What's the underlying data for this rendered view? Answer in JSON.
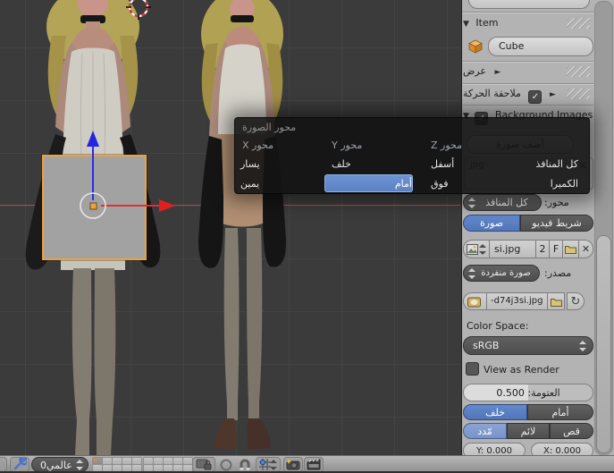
{
  "menu": {
    "title": "محور الصورة",
    "columns": [
      {
        "header": "محور X",
        "items": [
          "يسار",
          "يمين"
        ]
      },
      {
        "header": "محور Y",
        "items": [
          "خلف",
          "أمام"
        ]
      },
      {
        "header": "محور Z",
        "items": [
          "أسفل",
          "فوق"
        ]
      },
      {
        "header": "",
        "items": [
          "كل المنافذ",
          "الكميرا"
        ]
      }
    ],
    "selected": "أمام"
  },
  "sidebar": {
    "item_panel": {
      "title": "Item",
      "object_name": "Cube"
    },
    "display_panel": {
      "title": "عرض"
    },
    "motion_panel": {
      "title": "ملاحقة الحركة"
    },
    "background_panel": {
      "title": "Background Images",
      "add_image": "أضف صورة",
      "image_fragment": "jpg",
      "axis_label": "محور:",
      "axis_value": "كل المنافذ",
      "movie_clip": "شريط فيديو",
      "image": "صورة",
      "image_name": "si.jpg",
      "users": "2",
      "fake_user": "F",
      "source_label": "مصدر:",
      "source_value": "صورة منفردة",
      "file_path": "-d74j3si.jpg",
      "colorspace_label": "Color Space:",
      "colorspace_value": "sRGB",
      "view_as_render": "View as Render",
      "opacity": "العتومة: 0.500",
      "back": "خلف",
      "front": "أمام",
      "stretch": "مّدد",
      "fit": "لائم",
      "crop": "قص",
      "offset_x": "X: 0.000",
      "offset_y": "Y: 0.000"
    }
  },
  "toolbar": {
    "orientation": "عالمي0"
  },
  "colors": {
    "accent_blue": "#5b80c3",
    "select_orange": "#efa13a",
    "axis_x_red": "#e03030",
    "axis_z_blue": "#2b2be6",
    "sidebar_bg": "#b3b3b3",
    "menu_bg": "#131313"
  }
}
